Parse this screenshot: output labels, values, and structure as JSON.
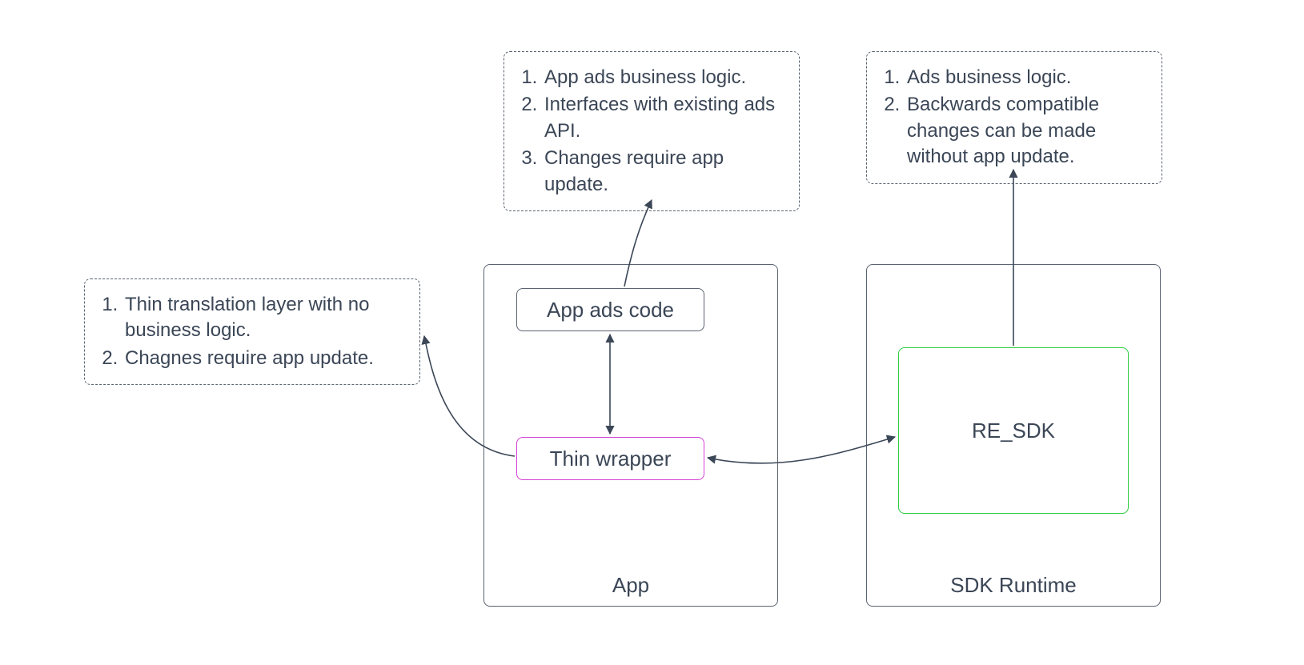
{
  "containers": {
    "app": {
      "label": "App"
    },
    "sdk_runtime": {
      "label": "SDK Runtime"
    }
  },
  "nodes": {
    "app_ads_code": "App ads code",
    "thin_wrapper": "Thin wrapper",
    "re_sdk": "RE_SDK"
  },
  "notes": {
    "top_middle": {
      "items": [
        "App ads business logic.",
        "Interfaces with existing ads API.",
        "Changes require app update."
      ]
    },
    "top_right": {
      "items": [
        "Ads business logic.",
        "Backwards compatible changes can be made without app update."
      ]
    },
    "left": {
      "items": [
        "Thin translation layer with no business logic.",
        "Chagnes require app update."
      ]
    }
  }
}
